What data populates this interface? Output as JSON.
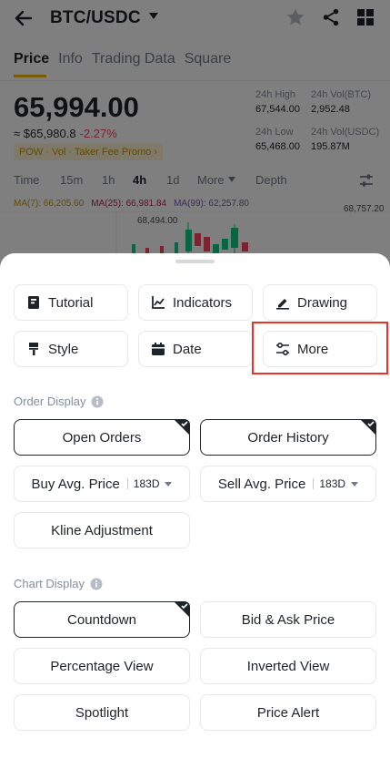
{
  "header": {
    "pair": "BTC/USDC"
  },
  "tabs": [
    "Price",
    "Info",
    "Trading Data",
    "Square"
  ],
  "price": {
    "last": "65,994.00",
    "fiat": "≈ $65,980.8",
    "change": "-2.27%",
    "promo": "POW · Vol · Taker Fee Promo ›"
  },
  "stats": {
    "high_label": "24h High",
    "high": "67,544.00",
    "low_label": "24h Low",
    "low": "65,468.00",
    "vol_btc_label": "24h Vol(BTC)",
    "vol_btc": "2,952.48",
    "vol_usdc_label": "24h Vol(USDC)",
    "vol_usdc": "195.87M"
  },
  "intervals": {
    "time": "Time",
    "m15": "15m",
    "h1": "1h",
    "h4": "4h",
    "d1": "1d",
    "more": "More",
    "depth": "Depth"
  },
  "ma": {
    "ma7": "MA(7): 66,205.60",
    "ma25": "MA(25): 66,981.84",
    "ma99": "MA(99): 62,257.80"
  },
  "chart": {
    "high_label": "68,494.00",
    "axis_top": "68,757.20"
  },
  "sheet": {
    "tools": {
      "tutorial": "Tutorial",
      "indicators": "Indicators",
      "drawing": "Drawing",
      "style": "Style",
      "date": "Date",
      "more": "More"
    },
    "order_display": {
      "title": "Order Display",
      "open_orders": "Open Orders",
      "order_history": "Order History",
      "buy_avg": "Buy Avg. Price",
      "buy_range": "183D",
      "sell_avg": "Sell Avg. Price",
      "sell_range": "183D",
      "kline_adjust": "Kline Adjustment"
    },
    "chart_display": {
      "title": "Chart Display",
      "countdown": "Countdown",
      "bid_ask": "Bid & Ask Price",
      "percentage_view": "Percentage View",
      "inverted_view": "Inverted View",
      "spotlight": "Spotlight",
      "price_alert": "Price Alert"
    }
  },
  "colors": {
    "accent": "#f0b90b",
    "down": "#f6465d",
    "up": "#0ecb81",
    "highlight": "#e8322b"
  }
}
